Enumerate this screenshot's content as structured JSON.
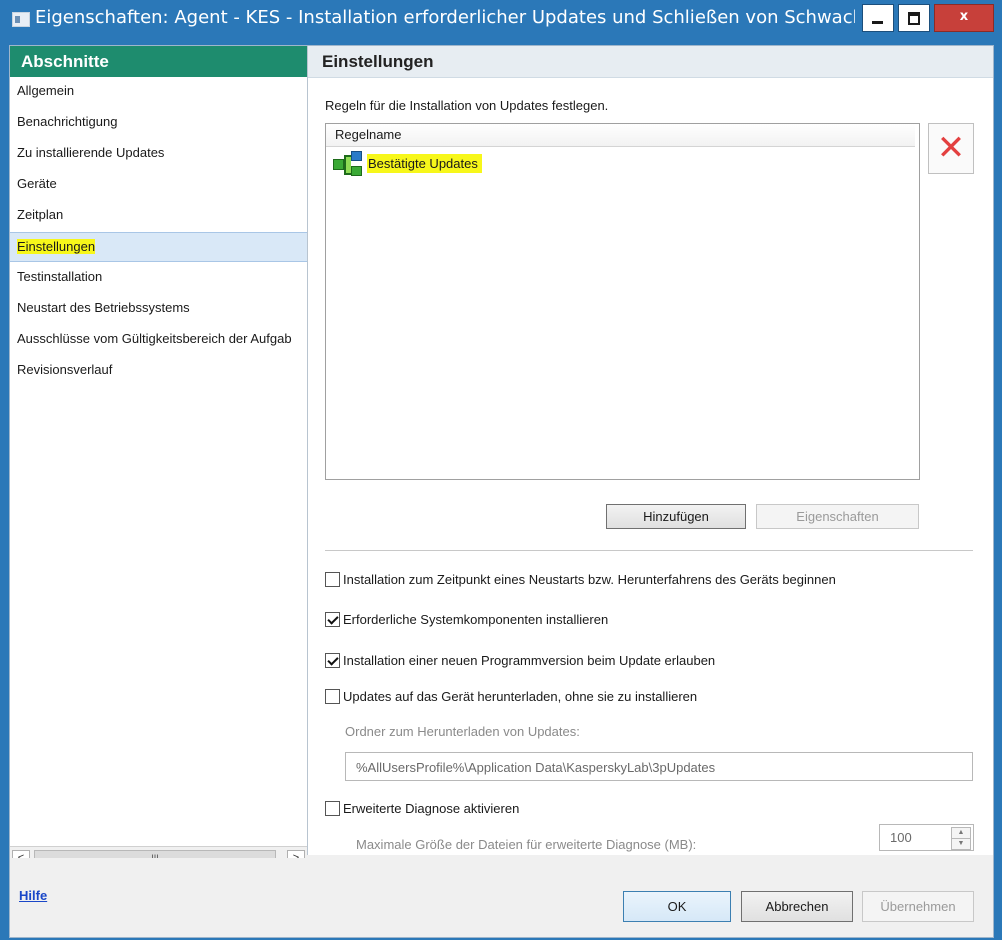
{
  "window": {
    "title": "Eigenschaften: Agent - KES - Installation erforderlicher Updates und Schließen von Schwachste..."
  },
  "sidebar": {
    "header": "Abschnitte",
    "items": [
      {
        "label": "Allgemein"
      },
      {
        "label": "Benachrichtigung"
      },
      {
        "label": "Zu installierende Updates"
      },
      {
        "label": "Geräte"
      },
      {
        "label": "Zeitplan"
      },
      {
        "label": "Einstellungen",
        "selected": true
      },
      {
        "label": "Testinstallation"
      },
      {
        "label": "Neustart des Betriebssystems"
      },
      {
        "label": "Ausschlüsse vom Gültigkeitsbereich der Aufgab"
      },
      {
        "label": "Revisionsverlauf"
      }
    ],
    "scroll_thumb_glyph": "III",
    "scroll_left": "<",
    "scroll_right": ">"
  },
  "panel": {
    "header": "Einstellungen",
    "intro": "Regeln für die Installation von Updates festlegen.",
    "rules_column": "Regelname",
    "rules": [
      {
        "name": "Bestätigte Updates"
      }
    ],
    "delete_glyph": "✕",
    "add_button": "Hinzufügen",
    "properties_button": "Eigenschaften",
    "options": [
      {
        "label": "Installation zum Zeitpunkt eines Neustarts bzw. Herunterfahrens des Geräts beginnen",
        "checked": false
      },
      {
        "label": "Erforderliche Systemkomponenten installieren",
        "checked": true
      },
      {
        "label": "Installation einer neuen Programmversion beim Update erlauben",
        "checked": true
      },
      {
        "label": "Updates auf das Gerät herunterladen, ohne sie zu installieren",
        "checked": false
      }
    ],
    "download_folder_label": "Ordner zum Herunterladen von Updates:",
    "download_folder_value": "%AllUsersProfile%\\Application Data\\KasperskyLab\\3pUpdates",
    "diagnostics": {
      "label": "Erweiterte Diagnose aktivieren",
      "checked": false
    },
    "max_size_label": "Maximale Größe der Dateien für erweiterte Diagnose (MB):",
    "max_size_value": "100"
  },
  "footer": {
    "help": "Hilfe",
    "ok": "OK",
    "cancel": "Abbrechen",
    "apply": "Übernehmen"
  }
}
